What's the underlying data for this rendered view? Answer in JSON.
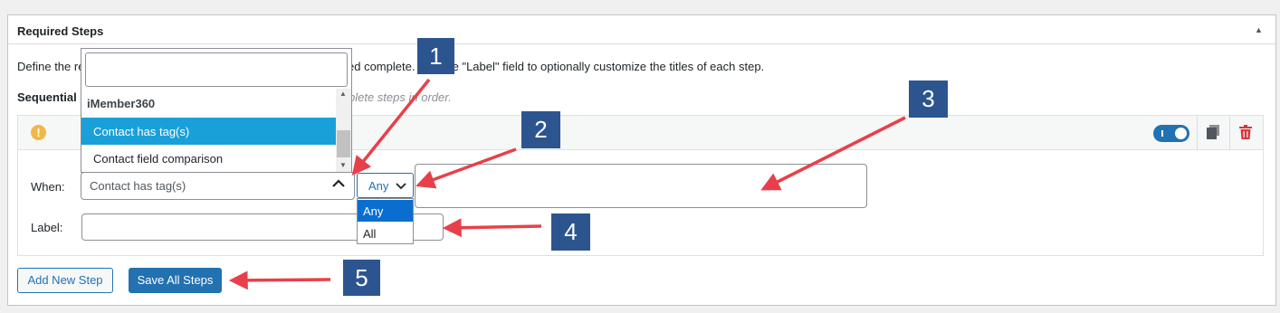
{
  "panel": {
    "title": "Required Steps",
    "description_left": "Define the re",
    "description_right": "ed complete. Use the \"Label\" field to optionally customize the titles of each step.",
    "sequential_label": "Sequential S",
    "sequential_help": "plete steps in order."
  },
  "step": {
    "when_label": "When:",
    "label_label": "Label:",
    "condition_value": "Contact has tag(s)",
    "match_value": "Any",
    "match_options": [
      "Any",
      "All"
    ],
    "toggle_on": true
  },
  "dropdown": {
    "search_value": "",
    "group": "iMember360",
    "options": [
      "Contact has tag(s)",
      "Contact field comparison"
    ],
    "highlighted": "Contact has tag(s)"
  },
  "buttons": {
    "add_step": "Add New Step",
    "save_all": "Save All Steps"
  },
  "callouts": [
    "1",
    "2",
    "3",
    "4",
    "5"
  ],
  "colors": {
    "accent": "#2271b1",
    "highlight": "#1aa0d8",
    "callout_bg": "#2c5590",
    "arrow": "#e8404a",
    "warning": "#f0b849",
    "trash": "#d63638"
  },
  "icons": [
    "warning-icon",
    "copy-icon",
    "trash-icon",
    "chevron-up-icon",
    "chevron-down-icon"
  ]
}
